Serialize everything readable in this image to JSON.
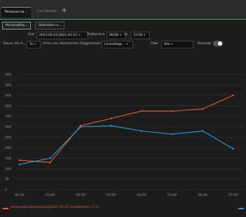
{
  "tabs": [
    {
      "label": "Personen za..."
    },
    {
      "label": "Live Ansicht..."
    }
  ],
  "add_tab_label": "+",
  "subtabs": [
    {
      "label": "Personalflus..."
    },
    {
      "label": "Statistiken a..."
    }
  ],
  "controls": {
    "time_label": "Zeit",
    "time_value": "2021-02-23-2021-02-23",
    "time_chevron": "▾",
    "interval_label": "Zeitbereich",
    "interval_start": "00:00",
    "interval_sep": "zu",
    "interval_end": "12:59",
    "duration_label": "Dauer des A...",
    "duration_value": "Tu",
    "chart_type_label": "Arten von statistischen Diagrammen",
    "chart_type_value": "Liniendiagr...",
    "filter_label": "Filter",
    "filter_value": "Alle",
    "contrast_label": "Kontrast"
  },
  "colors": {
    "series_orange": "#e0612e",
    "series_blue": "#2a9fd8",
    "grid": "#333333",
    "axis_text": "#9a9a9a"
  },
  "chart_data": {
    "type": "line",
    "categories": [
      "00:00",
      "01:00",
      "02:00",
      "03:00",
      "04:00",
      "05:00",
      "06:00",
      "07:00"
    ],
    "yticks": [
      0,
      50,
      100,
      150,
      200,
      250,
      300,
      350,
      400,
      450,
      500,
      550
    ],
    "ylim": [
      0,
      550
    ],
    "grid": true,
    "series": [
      {
        "name": "Verknuepfungsrechnung(2021-02-23 Vorabdaten++1 la",
        "color": "#e0612e",
        "values": [
          140,
          130,
          305,
          340,
          375,
          375,
          385,
          450
        ]
      },
      {
        "name": "",
        "color": "#2a9fd8",
        "values": [
          120,
          150,
          300,
          305,
          280,
          265,
          280,
          195
        ]
      }
    ],
    "legend_position": "bottom"
  }
}
